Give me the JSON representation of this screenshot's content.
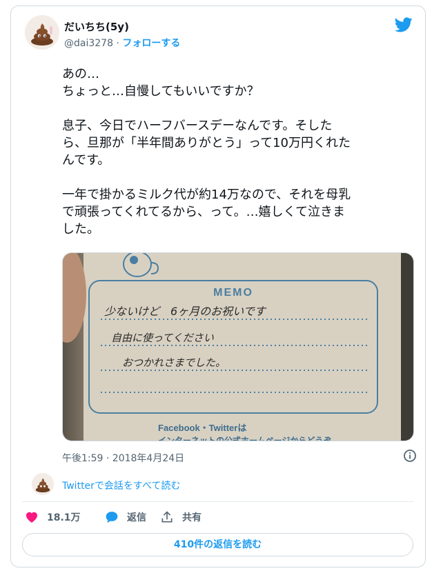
{
  "author": {
    "name": "だいちち(5y)",
    "handle": "@dai3278",
    "separator": " · ",
    "follow_label": "フォローする"
  },
  "tweet": {
    "text": "あの…\nちょっと…自慢してもいいですか？\n\n息子、今日でハーフバースデーなんです。そした\nら、旦那が「半年間ありがとう」って10万円くれた\nんです。\n\n一年で掛かるミルク代が約14万なので、それを母乳\nで頑張ってくれてるから、って。…嬉しくて泣きま\nした。",
    "timestamp": "午後1:59 · 2018年4月24日"
  },
  "photo": {
    "memo_title": "MEMO",
    "line1": "少ないけど　6ヶ月のお祝いです",
    "line2": "自由に使ってください",
    "line3": "おつかれさまでした。",
    "footer": "Facebook・Twitterは",
    "footer2": "インターネットの公式ホームページからどうぞ"
  },
  "conversation": {
    "read_label": "Twitterで会話をすべて読む"
  },
  "actions": {
    "like_count": "18.1万",
    "reply_label": "返信",
    "share_label": "共有"
  },
  "replies_button_label": "410件の返信を読む",
  "colors": {
    "accent": "#1d9bf0",
    "like": "#f91880",
    "text": "#0f1419",
    "muted": "#536471"
  },
  "icons": {
    "brand": "twitter-bird-icon",
    "info": "info-icon",
    "like": "heart-icon",
    "reply": "speech-bubble-icon",
    "share": "share-upload-icon"
  }
}
